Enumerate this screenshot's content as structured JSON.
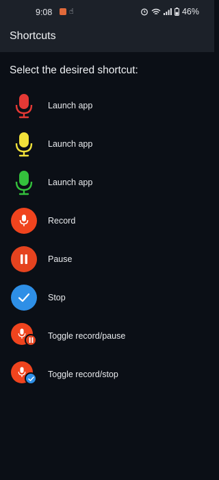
{
  "status_bar": {
    "time": "9:08",
    "battery": "46%",
    "notification_icon": "app-notification-icon",
    "hand_icon": "gesture-icon",
    "alarm_icon": "alarm-icon",
    "wifi_icon": "wifi-icon",
    "signal_icon": "signal-icon",
    "battery_icon": "battery-icon"
  },
  "app_bar": {
    "title": "Shortcuts"
  },
  "main": {
    "heading": "Select the desired shortcut:",
    "shortcuts": [
      {
        "label": "Launch app",
        "icon": "mic-icon-red",
        "color": "#e53935"
      },
      {
        "label": "Launch app",
        "icon": "mic-icon-yellow",
        "color": "#f2e23a"
      },
      {
        "label": "Launch app",
        "icon": "mic-icon-green",
        "color": "#34c13c"
      },
      {
        "label": "Record",
        "icon": "record-icon",
        "color": "#f0441e"
      },
      {
        "label": "Pause",
        "icon": "pause-icon",
        "color": "#e5431f"
      },
      {
        "label": "Stop",
        "icon": "stop-check-icon",
        "color": "#2e8fe6"
      },
      {
        "label": "Toggle record/pause",
        "icon": "toggle-record-pause-icon",
        "color": "#f0441e"
      },
      {
        "label": "Toggle record/stop",
        "icon": "toggle-record-stop-icon",
        "color": "#f0441e"
      }
    ]
  }
}
